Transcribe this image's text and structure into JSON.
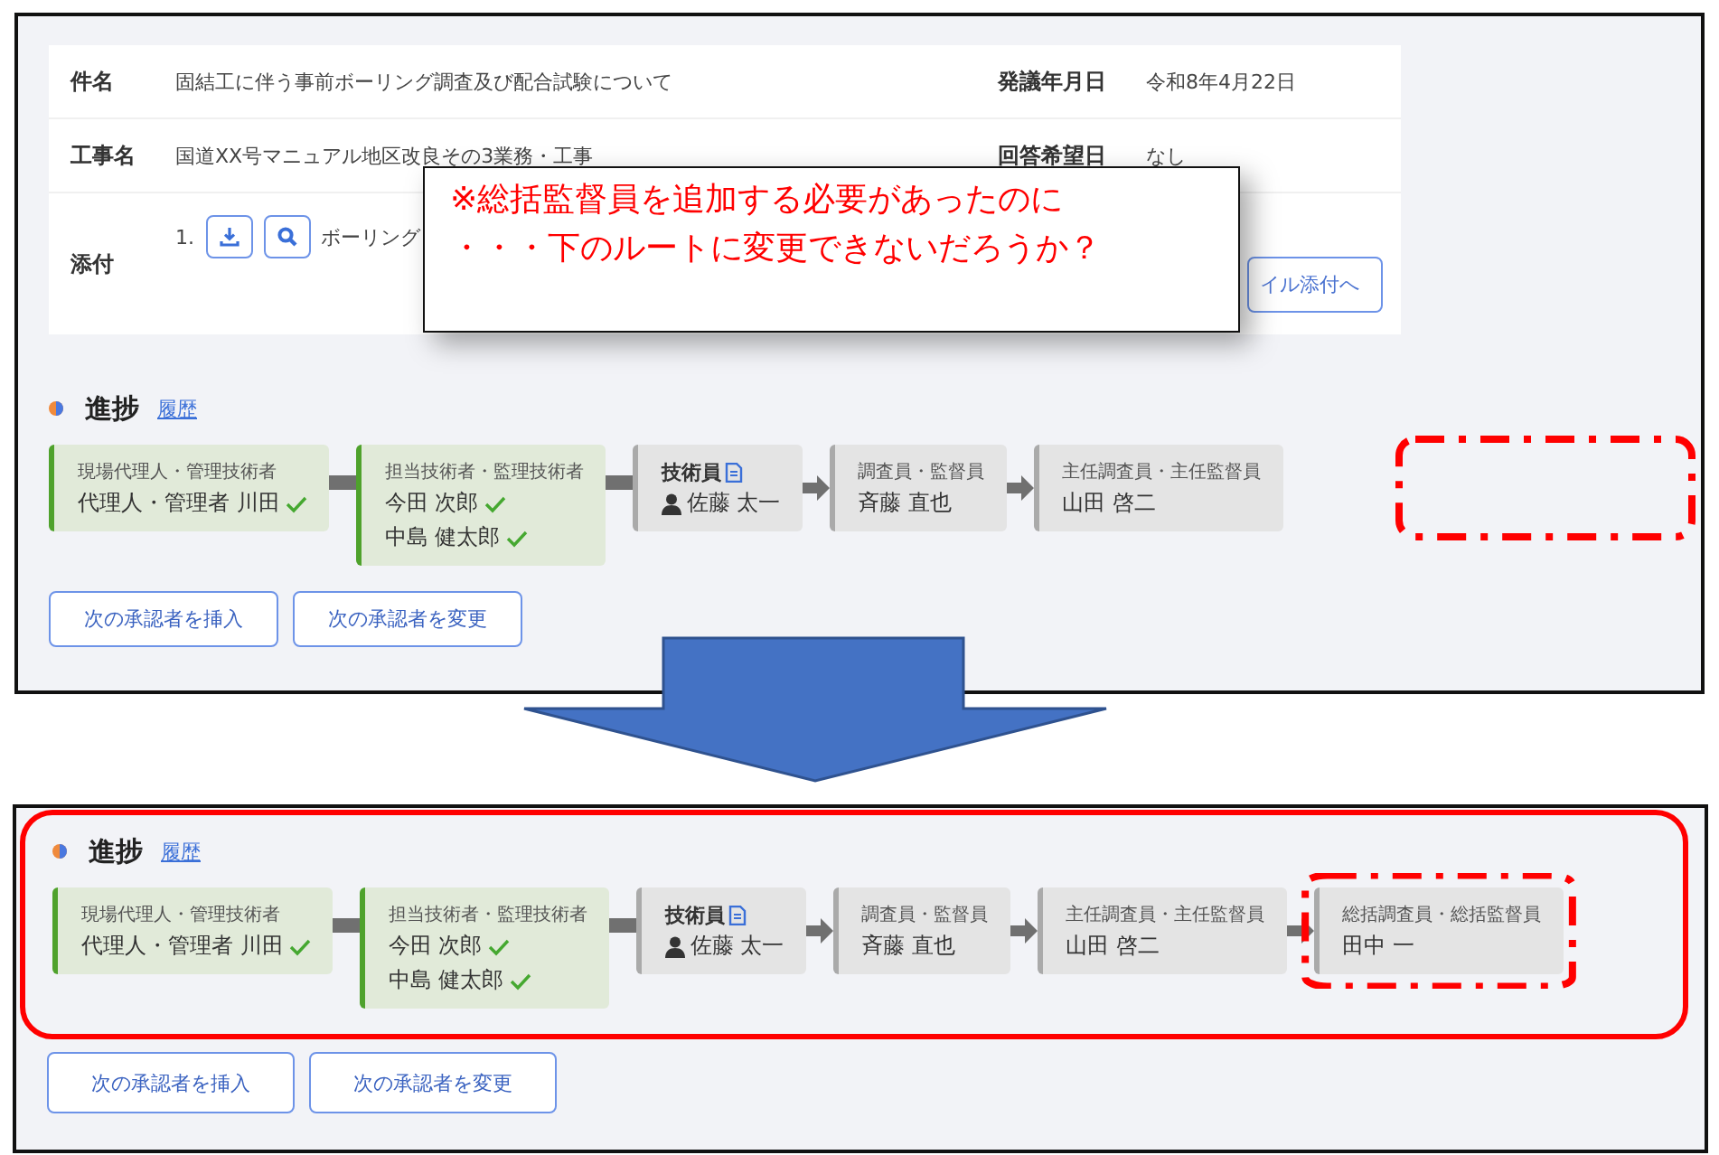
{
  "top_panel": {
    "info": [
      {
        "label": "件名",
        "value": "固結工に伴う事前ボーリング調査及び配合試験について",
        "side_label": "発議年月日",
        "side_value": "令和8年4月22日"
      },
      {
        "label": "工事名",
        "value": "国道XX号マニュアル地区改良その3業務・工事",
        "side_label": "回答希望日",
        "side_value": "なし"
      }
    ],
    "attachment": {
      "label": "添付",
      "index": "1.",
      "file_name": "ボーリング",
      "button": "イル添付へ"
    },
    "progress": {
      "title": "進捗",
      "history_link": "履歴",
      "highlighted": false,
      "empty_slot_highlighted": true,
      "steps": [
        {
          "kind": "approved",
          "role": "現場代理人・管理技術者",
          "names": [
            {
              "name": "代理人・管理者 川田",
              "approved": true
            }
          ],
          "highlighted": false
        },
        {
          "kind": "approved",
          "role": "担当技術者・監理技術者",
          "names": [
            {
              "name": "今田 次郎",
              "approved": true
            },
            {
              "name": "中島 健太郎",
              "approved": true
            }
          ],
          "highlighted": false
        },
        {
          "kind": "current",
          "role": "技術員",
          "names": [
            {
              "name": "佐藤 太一",
              "approved": false
            }
          ],
          "highlighted": false
        },
        {
          "kind": "pending",
          "role": "調査員・監督員",
          "names": [
            {
              "name": "斉藤 直也",
              "approved": false
            }
          ],
          "highlighted": false
        },
        {
          "kind": "pending",
          "role": "主任調査員・主任監督員",
          "names": [
            {
              "name": "山田 啓二",
              "approved": false
            }
          ],
          "highlighted": false
        }
      ],
      "buttons": [
        "次の承認者を挿入",
        "次の承認者を変更"
      ]
    }
  },
  "callout": {
    "lines": [
      "※総括監督員を追加する必要があったのに",
      "・・・下のルートに変更できないだろうか？"
    ]
  },
  "bottom_panel": {
    "progress": {
      "title": "進捗",
      "history_link": "履歴",
      "highlighted": true,
      "empty_slot_highlighted": false,
      "steps": [
        {
          "kind": "approved",
          "role": "現場代理人・管理技術者",
          "names": [
            {
              "name": "代理人・管理者 川田",
              "approved": true
            }
          ],
          "highlighted": false
        },
        {
          "kind": "approved",
          "role": "担当技術者・監理技術者",
          "names": [
            {
              "name": "今田 次郎",
              "approved": true
            },
            {
              "name": "中島 健太郎",
              "approved": true
            }
          ],
          "highlighted": false
        },
        {
          "kind": "current",
          "role": "技術員",
          "names": [
            {
              "name": "佐藤 太一",
              "approved": false
            }
          ],
          "highlighted": false
        },
        {
          "kind": "pending",
          "role": "調査員・監督員",
          "names": [
            {
              "name": "斉藤 直也",
              "approved": false
            }
          ],
          "highlighted": false
        },
        {
          "kind": "pending",
          "role": "主任調査員・主任監督員",
          "names": [
            {
              "name": "山田 啓二",
              "approved": false
            }
          ],
          "highlighted": false
        },
        {
          "kind": "pending",
          "role": "総括調査員・総括監督員",
          "names": [
            {
              "name": "田中 一",
              "approved": false
            }
          ],
          "highlighted": true
        }
      ],
      "buttons": [
        "次の承認者を挿入",
        "次の承認者を変更"
      ]
    }
  }
}
